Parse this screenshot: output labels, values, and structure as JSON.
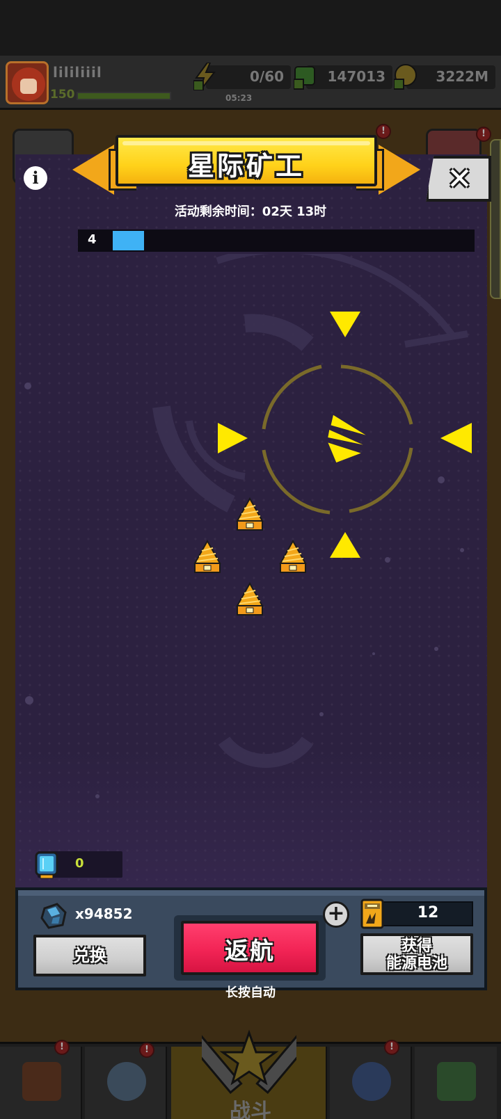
{
  "player": {
    "name": "lililiiil",
    "level": "150"
  },
  "resources": {
    "energy": "0/60",
    "energy_timer": "05:23",
    "cash": "147013",
    "gold": "3222M"
  },
  "modal": {
    "title": "星际矿工",
    "timer": "活动剩余时间：02天 13时",
    "progress_level": "4",
    "progress_fraction": 0.087
  },
  "field": {
    "gem_count": "0"
  },
  "panel": {
    "ore_count": "x94852",
    "exchange_label": "兑换",
    "return_label": "返航",
    "hint": "长按自动",
    "battery_count": "12",
    "battery_button_line1": "获得",
    "battery_button_line2": "能源电池",
    "plus_glyph": "+"
  },
  "nav": {
    "fight_label": "战斗"
  },
  "colors": {
    "modal_bg": "#2c2140",
    "banner_yellow": "#ffd21a",
    "return_red": "#f22455",
    "progress_blue": "#3fb2f5",
    "arrow_yellow": "#ffe900",
    "gem_count": "#c9e03a"
  },
  "icons": {
    "info": "info-icon",
    "close": "close-icon",
    "ore": "ore-icon",
    "battery": "battery-icon",
    "gem": "gem-icon",
    "drill": "drill-icon",
    "ship": "ship-icon"
  }
}
